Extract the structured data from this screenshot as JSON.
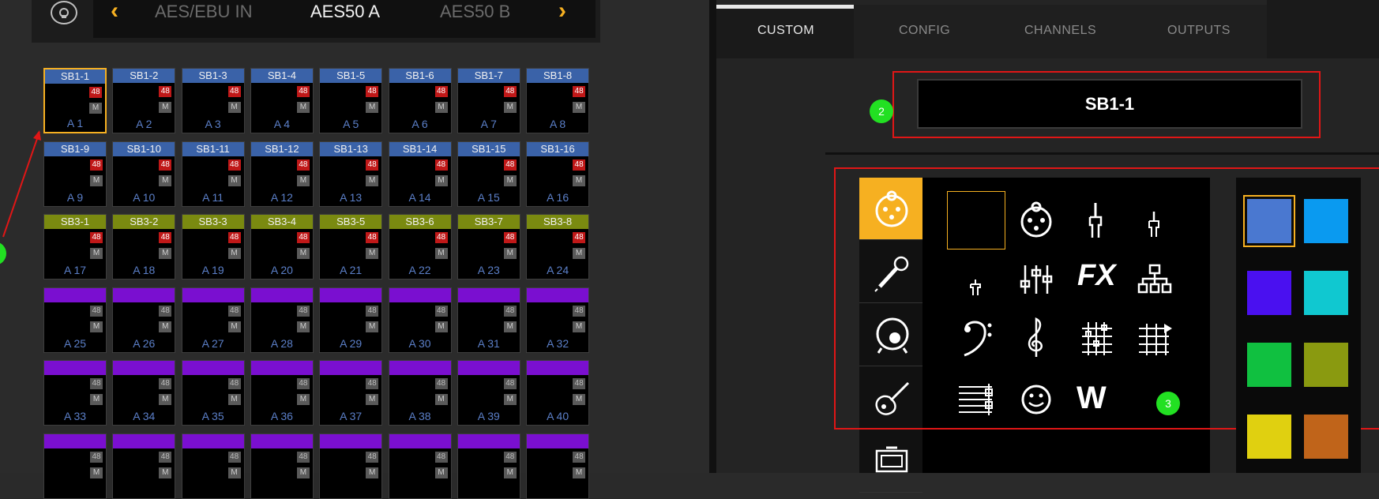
{
  "nav": {
    "items": [
      "AES/EBU IN",
      "AES50 A",
      "AES50 B"
    ],
    "active": "AES50 A",
    "left_arrow": "‹",
    "right_arrow": "›"
  },
  "grid": {
    "rows": [
      {
        "cells": [
          {
            "name": "SB1-1",
            "label": "A 1",
            "color": "blue",
            "phantom": true
          },
          {
            "name": "SB1-2",
            "label": "A 2",
            "color": "blue",
            "phantom": true
          },
          {
            "name": "SB1-3",
            "label": "A 3",
            "color": "blue",
            "phantom": true
          },
          {
            "name": "SB1-4",
            "label": "A 4",
            "color": "blue",
            "phantom": true
          },
          {
            "name": "SB1-5",
            "label": "A 5",
            "color": "blue",
            "phantom": true
          },
          {
            "name": "SB1-6",
            "label": "A 6",
            "color": "blue",
            "phantom": true
          },
          {
            "name": "SB1-7",
            "label": "A 7",
            "color": "blue",
            "phantom": true
          },
          {
            "name": "SB1-8",
            "label": "A 8",
            "color": "blue",
            "phantom": true
          }
        ]
      },
      {
        "cells": [
          {
            "name": "SB1-9",
            "label": "A 9",
            "color": "blue",
            "phantom": true
          },
          {
            "name": "SB1-10",
            "label": "A 10",
            "color": "blue",
            "phantom": true
          },
          {
            "name": "SB1-11",
            "label": "A 11",
            "color": "blue",
            "phantom": true
          },
          {
            "name": "SB1-12",
            "label": "A 12",
            "color": "blue",
            "phantom": true
          },
          {
            "name": "SB1-13",
            "label": "A 13",
            "color": "blue",
            "phantom": true
          },
          {
            "name": "SB1-14",
            "label": "A 14",
            "color": "blue",
            "phantom": true
          },
          {
            "name": "SB1-15",
            "label": "A 15",
            "color": "blue",
            "phantom": true
          },
          {
            "name": "SB1-16",
            "label": "A 16",
            "color": "blue",
            "phantom": true
          }
        ]
      },
      {
        "cells": [
          {
            "name": "SB3-1",
            "label": "A 17",
            "color": "olive",
            "phantom": true
          },
          {
            "name": "SB3-2",
            "label": "A 18",
            "color": "olive",
            "phantom": true
          },
          {
            "name": "SB3-3",
            "label": "A 19",
            "color": "olive",
            "phantom": true
          },
          {
            "name": "SB3-4",
            "label": "A 20",
            "color": "olive",
            "phantom": true
          },
          {
            "name": "SB3-5",
            "label": "A 21",
            "color": "olive",
            "phantom": true
          },
          {
            "name": "SB3-6",
            "label": "A 22",
            "color": "olive",
            "phantom": true
          },
          {
            "name": "SB3-7",
            "label": "A 23",
            "color": "olive",
            "phantom": true
          },
          {
            "name": "SB3-8",
            "label": "A 24",
            "color": "olive",
            "phantom": true
          }
        ]
      },
      {
        "cells": [
          {
            "name": "",
            "label": "A 25",
            "color": "purple",
            "phantom": false
          },
          {
            "name": "",
            "label": "A 26",
            "color": "purple",
            "phantom": false
          },
          {
            "name": "",
            "label": "A 27",
            "color": "purple",
            "phantom": false
          },
          {
            "name": "",
            "label": "A 28",
            "color": "purple",
            "phantom": false
          },
          {
            "name": "",
            "label": "A 29",
            "color": "purple",
            "phantom": false
          },
          {
            "name": "",
            "label": "A 30",
            "color": "purple",
            "phantom": false
          },
          {
            "name": "",
            "label": "A 31",
            "color": "purple",
            "phantom": false
          },
          {
            "name": "",
            "label": "A 32",
            "color": "purple",
            "phantom": false
          }
        ]
      },
      {
        "cells": [
          {
            "name": "",
            "label": "A 33",
            "color": "purple",
            "phantom": false
          },
          {
            "name": "",
            "label": "A 34",
            "color": "purple",
            "phantom": false
          },
          {
            "name": "",
            "label": "A 35",
            "color": "purple",
            "phantom": false
          },
          {
            "name": "",
            "label": "A 36",
            "color": "purple",
            "phantom": false
          },
          {
            "name": "",
            "label": "A 37",
            "color": "purple",
            "phantom": false
          },
          {
            "name": "",
            "label": "A 38",
            "color": "purple",
            "phantom": false
          },
          {
            "name": "",
            "label": "A 39",
            "color": "purple",
            "phantom": false
          },
          {
            "name": "",
            "label": "A 40",
            "color": "purple",
            "phantom": false
          }
        ]
      },
      {
        "cells": [
          {
            "name": "",
            "label": "",
            "color": "purple",
            "phantom": false
          },
          {
            "name": "",
            "label": "",
            "color": "purple",
            "phantom": false
          },
          {
            "name": "",
            "label": "",
            "color": "purple",
            "phantom": false
          },
          {
            "name": "",
            "label": "",
            "color": "purple",
            "phantom": false
          },
          {
            "name": "",
            "label": "",
            "color": "purple",
            "phantom": false
          },
          {
            "name": "",
            "label": "",
            "color": "purple",
            "phantom": false
          },
          {
            "name": "",
            "label": "",
            "color": "purple",
            "phantom": false
          },
          {
            "name": "",
            "label": "",
            "color": "purple",
            "phantom": false
          }
        ]
      }
    ],
    "badge_48": "48",
    "badge_m": "M",
    "selected": "SB1-1"
  },
  "colors": {
    "blue": "#3a62a8",
    "olive": "#7a8a10",
    "purple": "#7a0fd0",
    "accent": "#f6b021",
    "phantom_on": "#c01818",
    "phantom_off": "#555555",
    "annotation_red": "#e01616",
    "marker_green": "#22e022"
  },
  "tabs": [
    "CUSTOM",
    "CONFIG",
    "CHANNELS",
    "OUTPUTS"
  ],
  "active_tab": "CUSTOM",
  "name_field": {
    "value": "SB1-1"
  },
  "markers": {
    "left": "",
    "name": "2",
    "icons": "3"
  },
  "categories": [
    "xlr-connector-icon",
    "microphone-icon",
    "kick-drum-icon",
    "guitar-icon",
    "amplifier-icon"
  ],
  "selected_category": "xlr-connector-icon",
  "icons": [
    "blank-icon",
    "xlr-icon",
    "jack-trs-icon",
    "jack-small-icon",
    "jack-mini-icon",
    "mixer-faders-icon",
    "fx-icon",
    "network-icon",
    "bass-clef-icon",
    "treble-clef-icon",
    "grid-meter-icon",
    "grid-arrow-icon",
    "staff-icon",
    "smiley-icon",
    "w-logo-icon"
  ],
  "icon_texts": {
    "fx": "FX",
    "w": "W"
  },
  "swatches": [
    "#4a78d0",
    "#0a9af0",
    "#4a10f0",
    "#10c8d0",
    "#10c040",
    "#8a9a10",
    "#e0d010",
    "#c0641a"
  ],
  "selected_swatch": "#4a78d0"
}
